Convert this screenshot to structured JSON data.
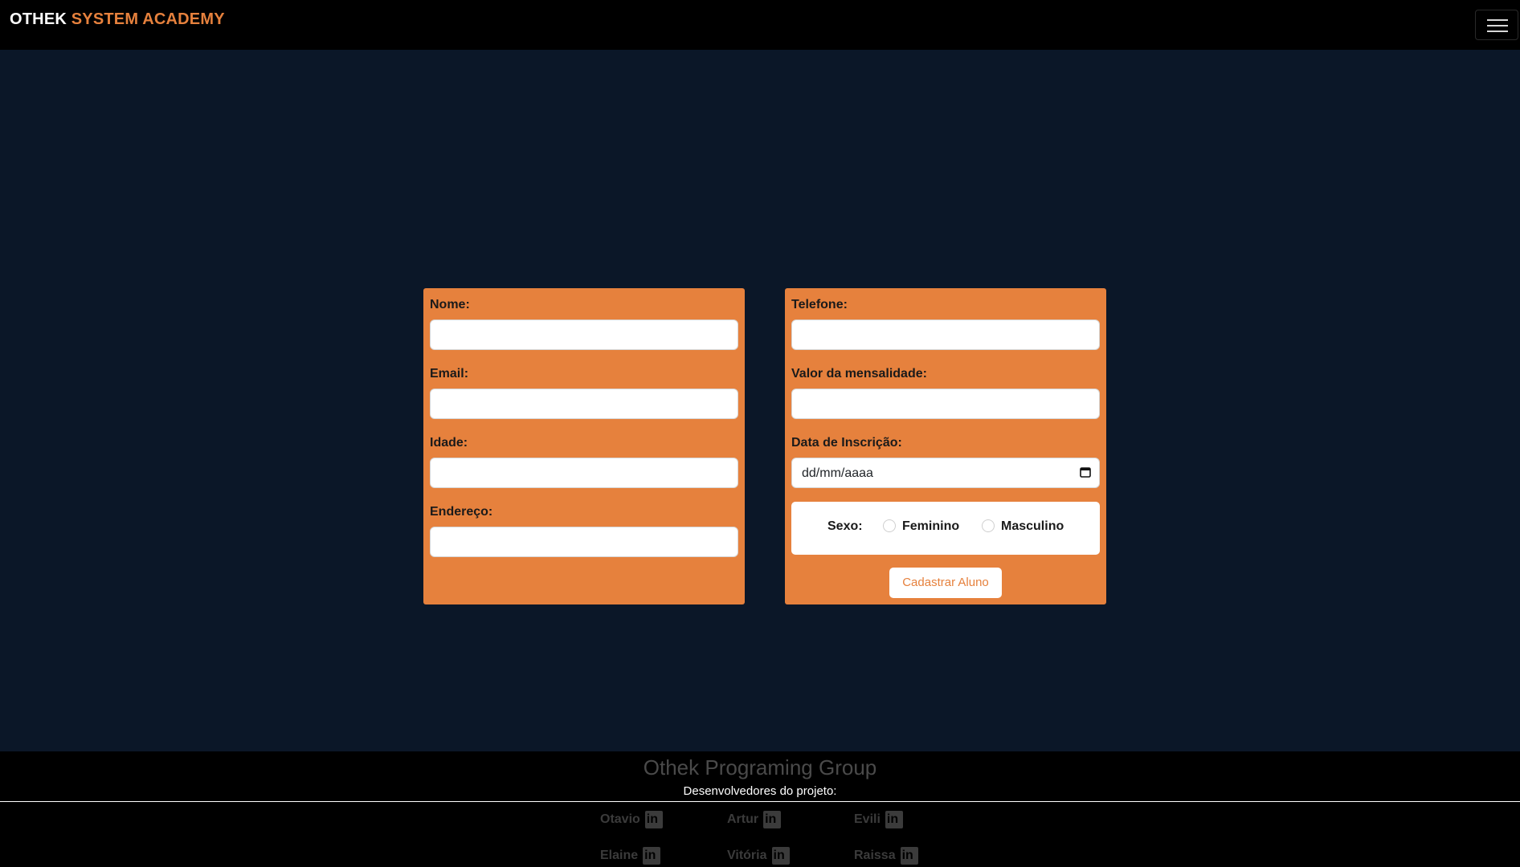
{
  "navbar": {
    "brand_part1": "OTHEK",
    "brand_part2": "SYSTEM ACADEMY",
    "menu_icon": "hamburger-icon"
  },
  "form": {
    "left": {
      "nome_label": "Nome:",
      "email_label": "Email:",
      "idade_label": "Idade:",
      "endereco_label": "Endereço:"
    },
    "right": {
      "telefone_label": "Telefone:",
      "mensalidade_label": "Valor da mensalidade:",
      "data_label": "Data de Inscrição:",
      "data_placeholder": "dd/mm/aaaa",
      "calendar_icon": "calendar-icon",
      "sexo_label": "Sexo:",
      "feminino_label": "Feminino",
      "masculino_label": "Masculino",
      "submit_label": "Cadastrar Aluno"
    }
  },
  "footer": {
    "title": "Othek Programing Group",
    "subtitle": "Desenvolvedores do projeto:",
    "developers": [
      {
        "name": "Otavio",
        "icon": "linkedin-icon"
      },
      {
        "name": "Artur",
        "icon": "linkedin-icon"
      },
      {
        "name": "Evili",
        "icon": "linkedin-icon"
      },
      {
        "name": "Elaine",
        "icon": "linkedin-icon"
      },
      {
        "name": "Vitória",
        "icon": "linkedin-icon"
      },
      {
        "name": "Raissa",
        "icon": "linkedin-icon"
      }
    ],
    "linkedin_glyph": "in"
  },
  "colors": {
    "accent": "#e6813d",
    "background": "#0b1728",
    "navbar": "#000000"
  }
}
